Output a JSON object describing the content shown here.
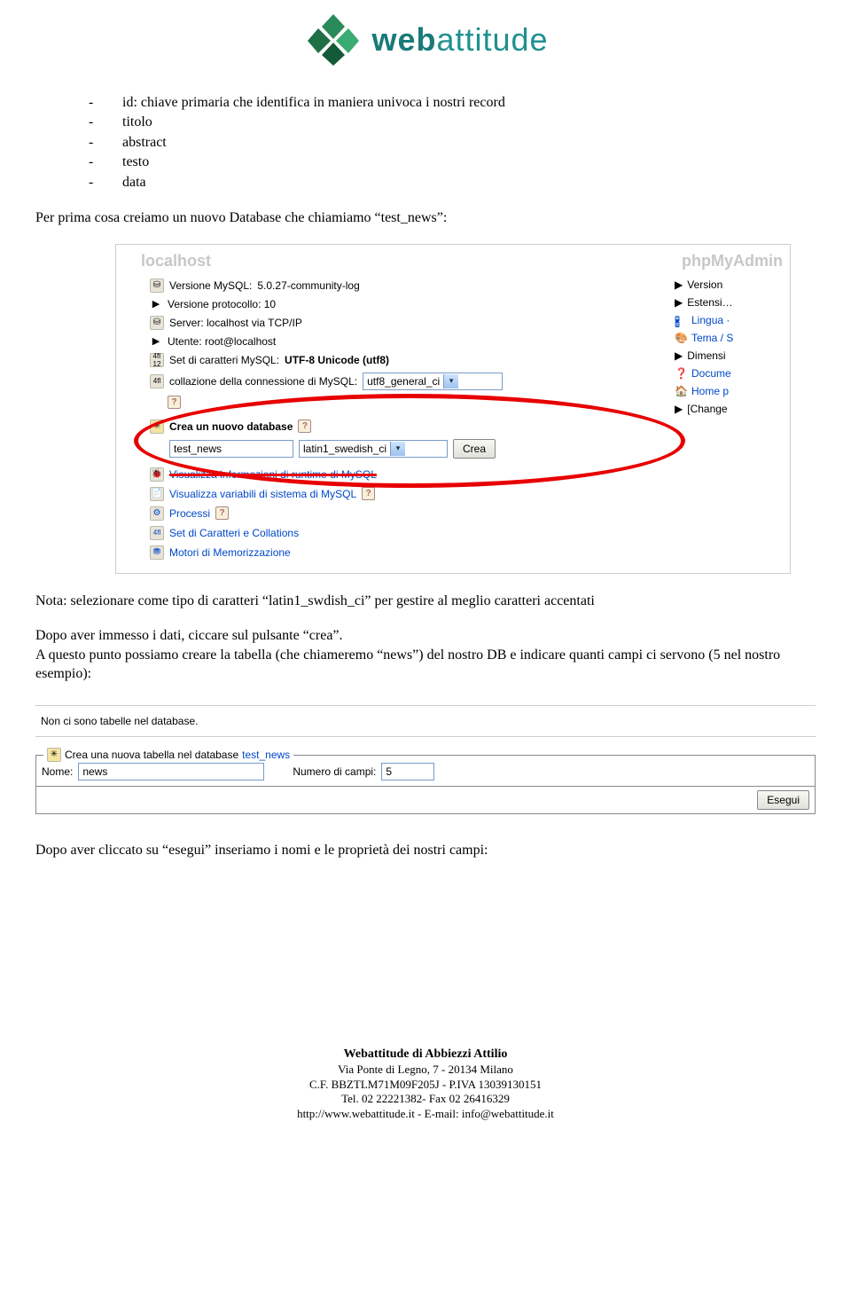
{
  "logo": {
    "bold": "web",
    "light": "attitude"
  },
  "bullets": [
    "id: chiave primaria che identifica in maniera univoca i nostri record",
    "titolo",
    "abstract",
    "testo",
    "data"
  ],
  "para1": "Per prima cosa creiamo un nuovo Database che chiamiamo “test_news”:",
  "shot1": {
    "breadcrumb_left": "localhost",
    "breadcrumb_right": "phpMyAdmin",
    "lines": {
      "mysql_ver_label": "Versione MySQL:",
      "mysql_ver_value": "5.0.27-community-log",
      "proto_label": "Versione protocollo: 10",
      "server_label": "Server: localhost via TCP/IP",
      "user_label": "Utente: root@localhost",
      "charset_label": "Set di caratteri MySQL:",
      "charset_value": "UTF-8 Unicode (utf8)",
      "collation_label": "collazione della connessione di MySQL:",
      "collation_value": "utf8_general_ci"
    },
    "create": {
      "title": "Crea un nuovo database",
      "db_name": "test_news",
      "collation": "latin1_swedish_ci",
      "button": "Crea"
    },
    "links": {
      "runtime": "Visualizza informazioni di runtime di MySQL",
      "vars": "Visualizza variabili di sistema di MySQL",
      "proc": "Processi",
      "charsets": "Set di Caratteri e Collations",
      "engines": "Motori di Memorizzazione"
    },
    "right": [
      "Version",
      "Estensi…",
      "Lingua ·",
      "Tema / S",
      "Dimensi",
      "Docume",
      "Home p",
      "[Change"
    ]
  },
  "para2": "Nota: selezionare come tipo di caratteri “latin1_swdish_ci” per gestire al meglio caratteri accentati",
  "para3a": "Dopo aver immesso i dati, ciccare sul pulsante “crea”.",
  "para3b": "A questo punto possiamo creare la tabella (che chiameremo “news”) del nostro DB e indicare quanti campi ci servono (5 nel nostro esempio):",
  "shot2": {
    "msg": "Non ci sono tabelle nel database.",
    "legend_prefix": "Crea una nuova tabella nel database",
    "legend_db": "test_news",
    "name_label": "Nome:",
    "name_value": "news",
    "fields_label": "Numero di campi:",
    "fields_value": "5",
    "exec": "Esegui"
  },
  "para4": "Dopo aver cliccato su “esegui” inseriamo i nomi e le proprietà dei nostri campi:",
  "footer": {
    "l1": "Webattitude di Abbiezzi Attilio",
    "l2": "Via Ponte di Legno, 7 - 20134 Milano",
    "l3": "C.F. BBZTLM71M09F205J - P.IVA 13039130151",
    "l4": "Tel. 02 22221382- Fax 02 26416329",
    "l5": "http://www.webattitude.it - E-mail: info@webattitude.it"
  }
}
